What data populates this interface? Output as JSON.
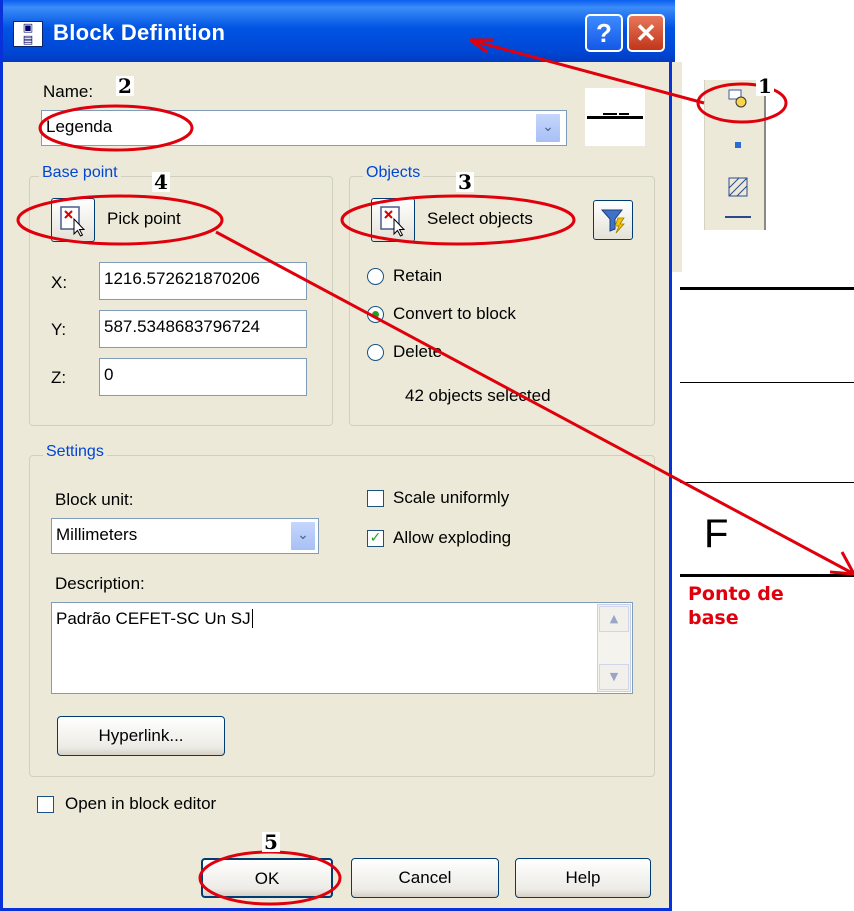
{
  "dialog": {
    "title": "Block Definition",
    "help_button": "?",
    "close_button": "✕",
    "name_label": "Name:",
    "name_value": "Legenda",
    "base_point": {
      "legend": "Base point",
      "pick_label": "Pick point",
      "x_label": "X:",
      "x_value": "1216.572621870206",
      "y_label": "Y:",
      "y_value": "587.5348683796724",
      "z_label": "Z:",
      "z_value": "0"
    },
    "objects": {
      "legend": "Objects",
      "select_label": "Select objects",
      "options": [
        "Retain",
        "Convert to block",
        "Delete"
      ],
      "selected_option": "Convert to block",
      "count_text": "42 objects selected"
    },
    "settings": {
      "legend": "Settings",
      "block_unit_label": "Block unit:",
      "block_unit_value": "Millimeters",
      "scale_uniformly": "Scale uniformly",
      "scale_uniformly_checked": false,
      "allow_exploding": "Allow exploding",
      "allow_exploding_checked": true,
      "description_label": "Description:",
      "description_value": "Padrão CEFET-SC Un SJ",
      "hyperlink_button": "Hyperlink..."
    },
    "open_in_editor": "Open in block editor",
    "open_in_editor_checked": false,
    "ok_button": "OK",
    "cancel_button": "Cancel",
    "help_bottom_button": "Help"
  },
  "annotations": [
    "1",
    "2",
    "3",
    "4",
    "5"
  ],
  "drawing": {
    "letter": "F",
    "caption": "Ponto de base"
  },
  "colors": {
    "title_bar": "#0054e3",
    "dialog_bg": "#ece9d8",
    "group_legend": "#0046d5",
    "annotation": "#e0000c",
    "check_mark": "#21a121"
  }
}
